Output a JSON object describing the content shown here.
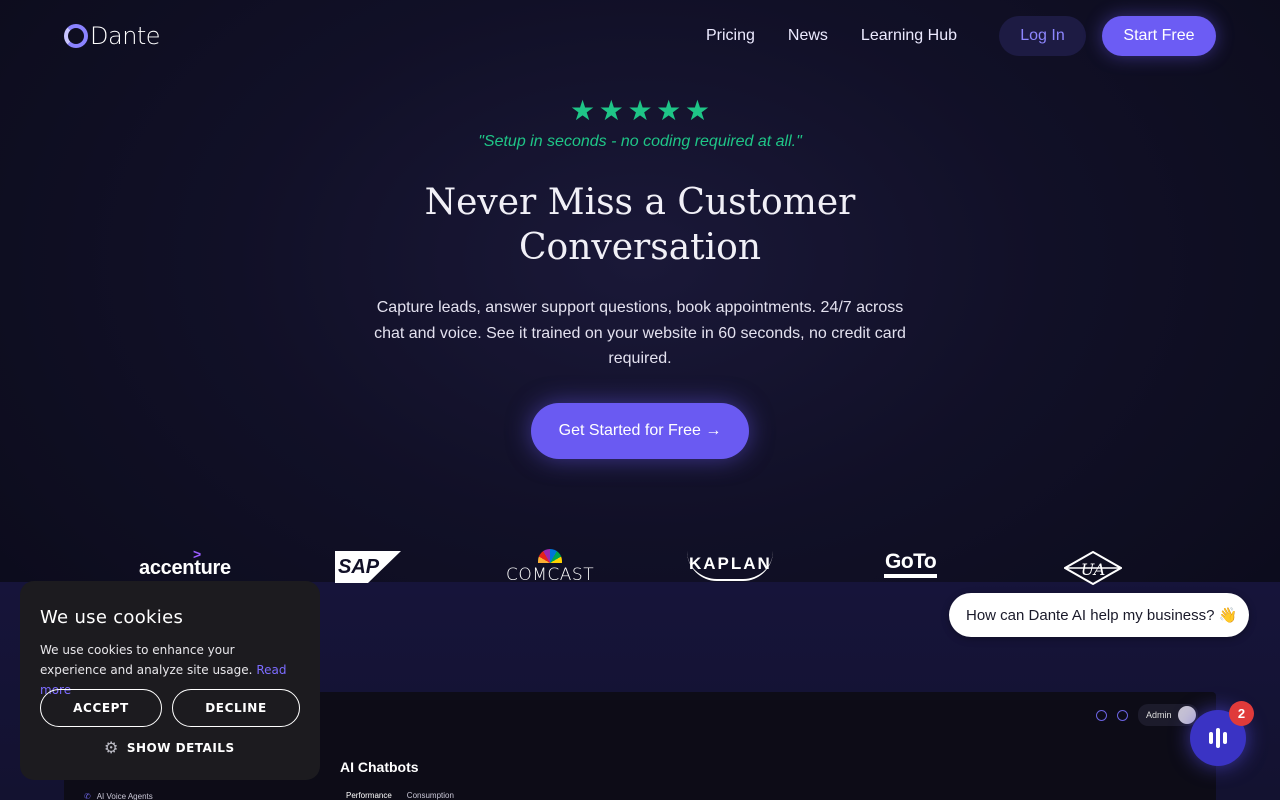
{
  "nav": {
    "brand": "Dante",
    "links": [
      "Pricing",
      "News",
      "Learning Hub"
    ],
    "login_label": "Log In",
    "start_label": "Start Free"
  },
  "hero": {
    "rating_stars": 5,
    "stars": [
      "★",
      "★",
      "★",
      "★",
      "★"
    ],
    "quote": "\"Setup in seconds - no coding required at all.\"",
    "headline": "Never Miss a Customer Conversation",
    "subtext": "Capture leads, answer support questions, book appointments. 24/7 across chat and voice. See it trained on your website in 60 seconds, no credit card required.",
    "cta_label": "Get Started for Free →",
    "accent_color": "#6a5af2",
    "star_color": "#1fc587"
  },
  "logos": {
    "accenture": "accenture",
    "sap": "SAP",
    "comcast": "COMCAST",
    "kaplan": "KAPLAN",
    "goto": "GoTo",
    "ua_icon": "universal-audio-logo"
  },
  "dashboard": {
    "admin_label": "Admin",
    "title": "AI Chatbots",
    "sidebar_item": "AI Voice Agents",
    "tabs": [
      "Performance",
      "Consumption"
    ]
  },
  "cookie": {
    "title": "We use cookies",
    "text": "We use cookies to enhance your experience and analyze site usage.",
    "link": "Read more",
    "accept": "ACCEPT",
    "decline": "DECLINE",
    "details": "SHOW DETAILS"
  },
  "chat": {
    "bubble_text": "How can Dante AI help my business? 👋",
    "badge_count": "2"
  }
}
